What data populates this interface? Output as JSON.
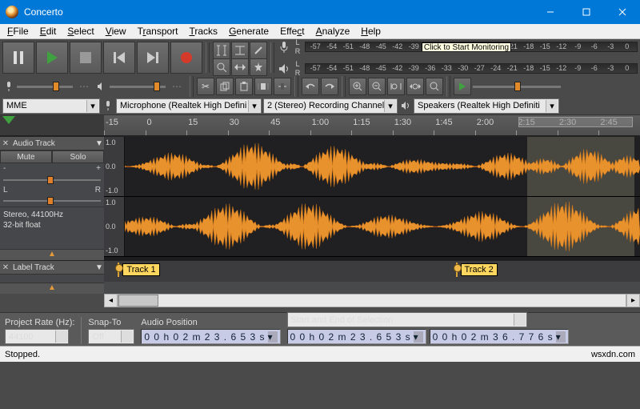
{
  "window": {
    "title": "Concerto"
  },
  "menu": [
    "File",
    "Edit",
    "Select",
    "View",
    "Transport",
    "Tracks",
    "Generate",
    "Effect",
    "Analyze",
    "Help"
  ],
  "meters": {
    "ticks": [
      "-57",
      "-54",
      "-51",
      "-48",
      "-45",
      "-42",
      "-39",
      "-36",
      "-33",
      "-30",
      "-27",
      "-24",
      "-21",
      "-18",
      "-15",
      "-12",
      "-9",
      "-6",
      "-3",
      "0"
    ],
    "mic_hint": "Click to Start Monitoring"
  },
  "devices": {
    "host": "MME",
    "input": "Microphone (Realtek High Defini",
    "channels": "2 (Stereo) Recording Channels",
    "output": "Speakers (Realtek High Definiti"
  },
  "ruler": {
    "labels": [
      "-15",
      "0",
      "15",
      "30",
      "45",
      "1:00",
      "1:15",
      "1:30",
      "1:45",
      "2:00",
      "2:15",
      "2:30",
      "2:45"
    ]
  },
  "tracks": {
    "audio": {
      "name": "Audio Track",
      "mute": "Mute",
      "solo": "Solo",
      "info1": "Stereo, 44100Hz",
      "info2": "32-bit float",
      "scale": [
        "1.0",
        "0.0",
        "-1.0"
      ]
    },
    "label": {
      "name": "Label Track",
      "marks": [
        {
          "text": "Track 1",
          "left_pct": 2
        },
        {
          "text": "Track 2",
          "left_pct": 65
        }
      ]
    }
  },
  "selection": {
    "rate_label": "Project Rate (Hz):",
    "rate": "44100",
    "snap_label": "Snap-To",
    "snap": "Off",
    "pos_label": "Audio Position",
    "pos": "0 0 h 0 2 m 2 3 . 6 5 3 s",
    "range_label": "Start and End of Selection",
    "start": "0 0 h 0 2 m 2 3 . 6 5 3 s",
    "end": "0 0 h 0 2 m 3 6 . 7 7 6 s"
  },
  "status": {
    "left": "Stopped.",
    "right": "wsxdn.com"
  }
}
